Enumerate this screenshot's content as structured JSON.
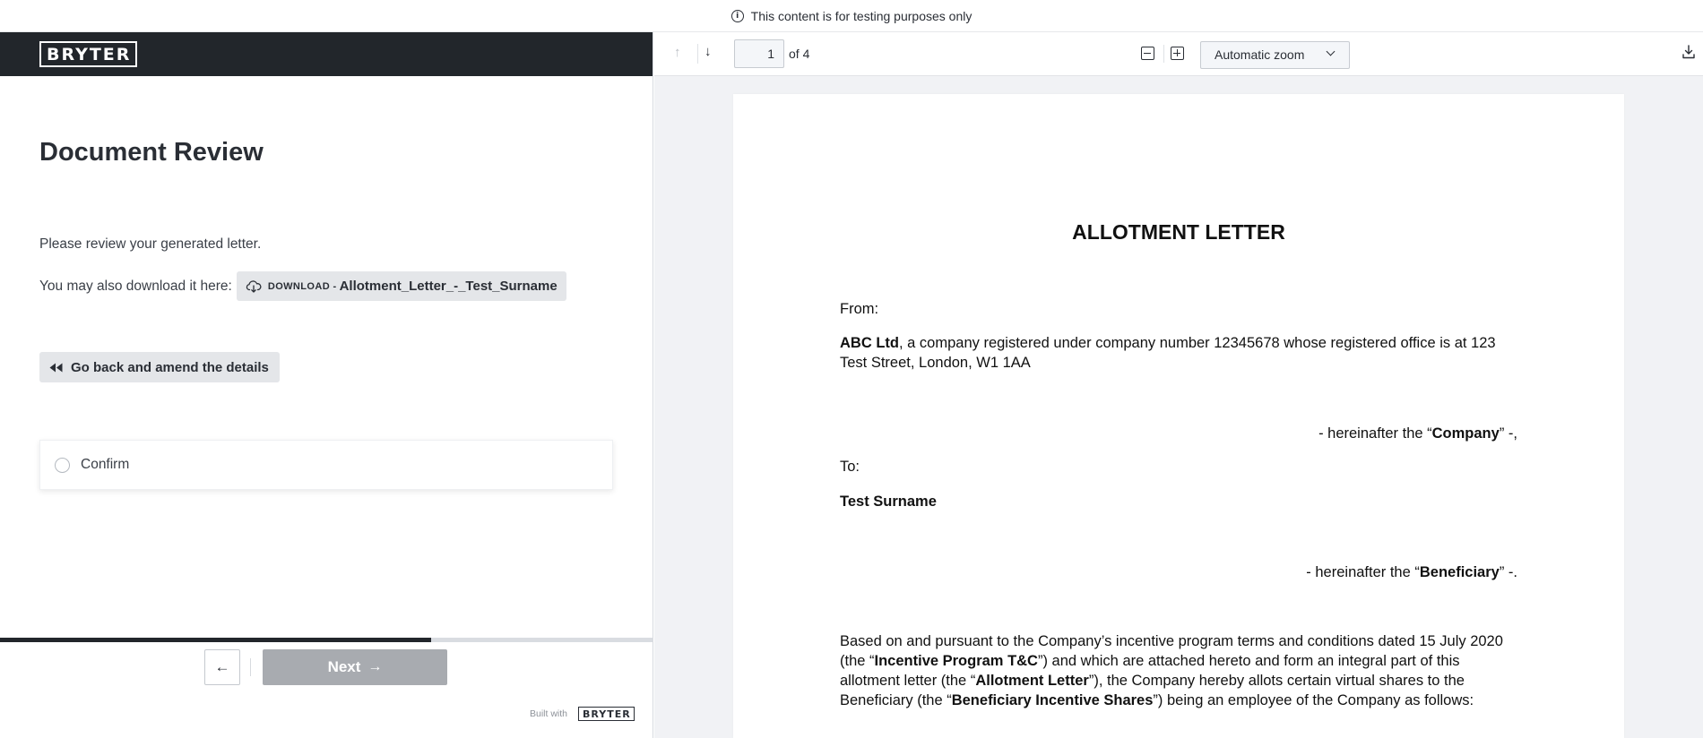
{
  "banner": {
    "text": "This content is for testing purposes only"
  },
  "brand": {
    "logo": "BRYTER"
  },
  "form": {
    "title": "Document Review",
    "review_text": "Please review your generated letter.",
    "download_label": "You may also download it here:",
    "download_prefix": "DOWNLOAD -",
    "download_file": "Allotment_Letter_-_Test_Surname",
    "back_button": "Go back and amend the details",
    "confirm_label": "Confirm",
    "progress_fraction": 0.66
  },
  "nav": {
    "prev_symbol": "←",
    "next_label": "Next",
    "next_symbol": "→"
  },
  "footer": {
    "built_with": "Built with",
    "logo": "BRYTER"
  },
  "viewer": {
    "up_symbol": "↑",
    "down_symbol": "↓",
    "page_current": "1",
    "page_of": "of 4",
    "zoom_value": "Automatic zoom"
  },
  "document": {
    "title": "ALLOTMENT LETTER",
    "from_label": "From:",
    "company_name": "ABC Ltd",
    "company_details": ", a company registered under company number 12345678 whose registered office is at 123 Test Street, London, W1 1AA",
    "company_ref_pre": "- hereinafter the “",
    "company_ref_term": "Company",
    "company_ref_post": "” -,",
    "to_label": "To:",
    "beneficiary_name": "Test Surname",
    "beneficiary_ref_pre": "- hereinafter the “",
    "beneficiary_ref_term": "Beneficiary",
    "beneficiary_ref_post": "” -.",
    "para_1": "Based on and pursuant to the Company’s incentive program terms and conditions dated 15 July 2020 (the “",
    "para_term_1": "Incentive Program T&C",
    "para_2": "”) and which are attached hereto and form an integral part of this allotment letter (the “",
    "para_term_2": "Allotment Letter",
    "para_3": "”), the Company hereby allots certain virtual shares to the Beneficiary (the “",
    "para_term_3": "Beneficiary Incentive Shares",
    "para_4": "”) being an employee of the Company as follows:"
  }
}
